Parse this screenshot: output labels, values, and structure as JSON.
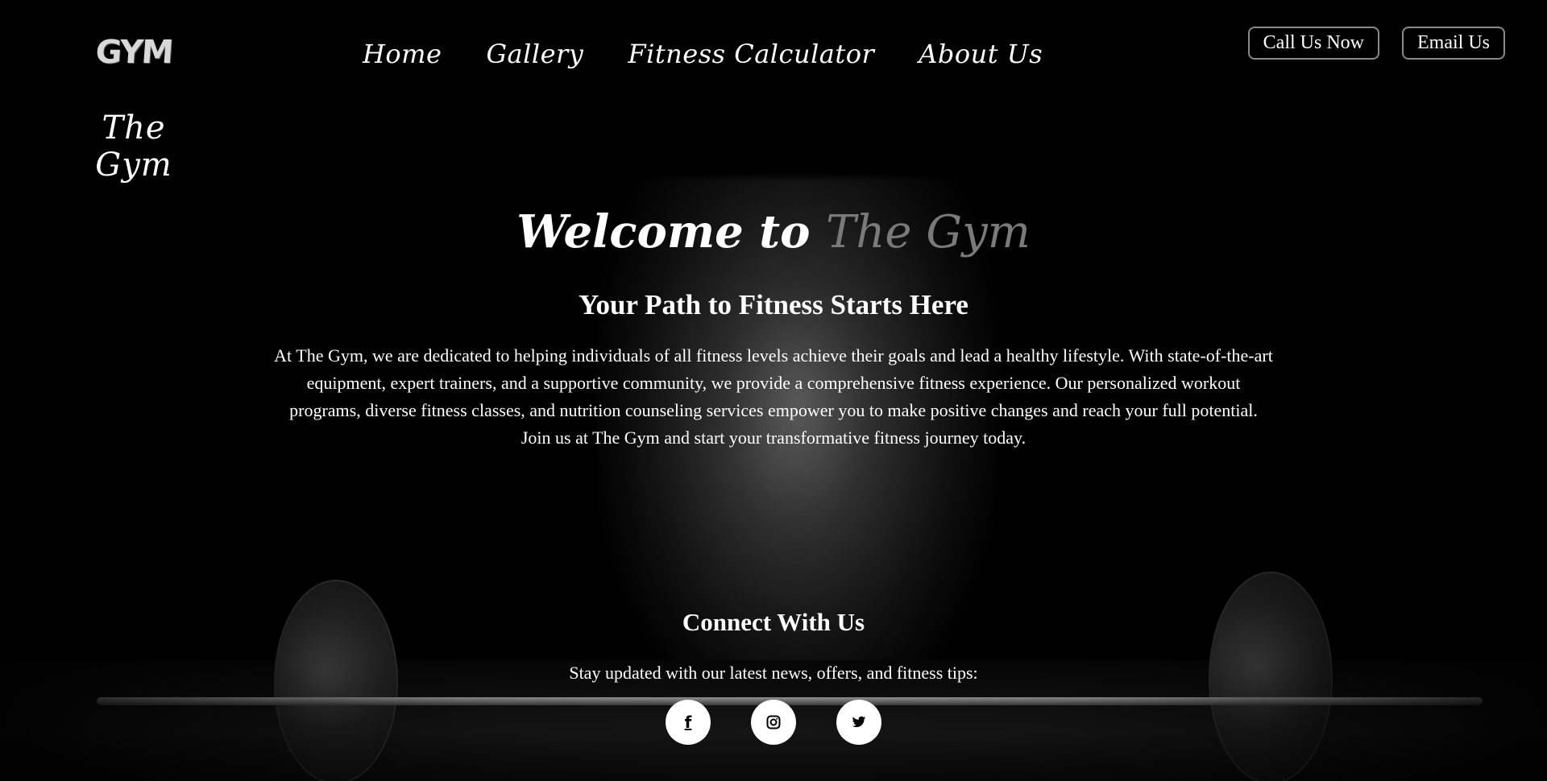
{
  "header": {
    "logo_mark": "GYM",
    "logo_text": "The Gym",
    "nav": [
      {
        "label": "Home"
      },
      {
        "label": "Gallery"
      },
      {
        "label": "Fitness Calculator"
      },
      {
        "label": "About Us"
      }
    ],
    "actions": {
      "call_label": "Call Us Now",
      "email_label": "Email Us"
    }
  },
  "hero": {
    "welcome_prefix": "Welcome to ",
    "welcome_brand": "The Gym",
    "subtitle": "Your Path to Fitness Starts Here",
    "description": "At The Gym, we are dedicated to helping individuals of all fitness levels achieve their goals and lead a healthy lifestyle. With state-of-the-art equipment, expert trainers, and a supportive community, we provide a comprehensive fitness experience. Our personalized workout programs, diverse fitness classes, and nutrition counseling services empower you to make positive changes and reach your full potential. Join us at The Gym and start your transformative fitness journey today."
  },
  "connect": {
    "title": "Connect With Us",
    "text": "Stay updated with our latest news, offers, and fitness tips:",
    "socials": [
      {
        "icon": "facebook-icon",
        "glyph": "f"
      },
      {
        "icon": "instagram-icon",
        "glyph": "◎"
      },
      {
        "icon": "twitter-icon",
        "glyph": "🐦"
      }
    ]
  },
  "colors": {
    "background": "#000000",
    "text": "#ffffff",
    "brand_accent": "#7a7a7a",
    "button_border": "#888888"
  }
}
